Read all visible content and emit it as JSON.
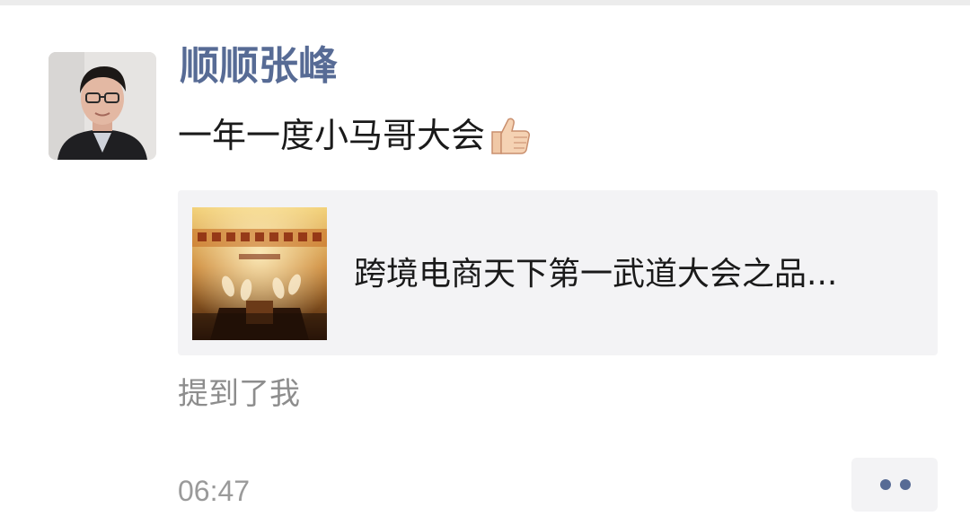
{
  "post": {
    "author": "顺顺张峰",
    "message": "一年一度小马哥大会",
    "emoji": "thumbs-up-icon",
    "link": {
      "title": "跨境电商天下第一武道大会之品...",
      "thumbnail": "event-banner-image"
    },
    "mention_text": "提到了我",
    "time": "06:47",
    "more_icon": "ellipsis-icon"
  },
  "colors": {
    "author_name": "#576b95",
    "card_background": "#f3f3f5",
    "meta_text": "#9a9a9a"
  }
}
